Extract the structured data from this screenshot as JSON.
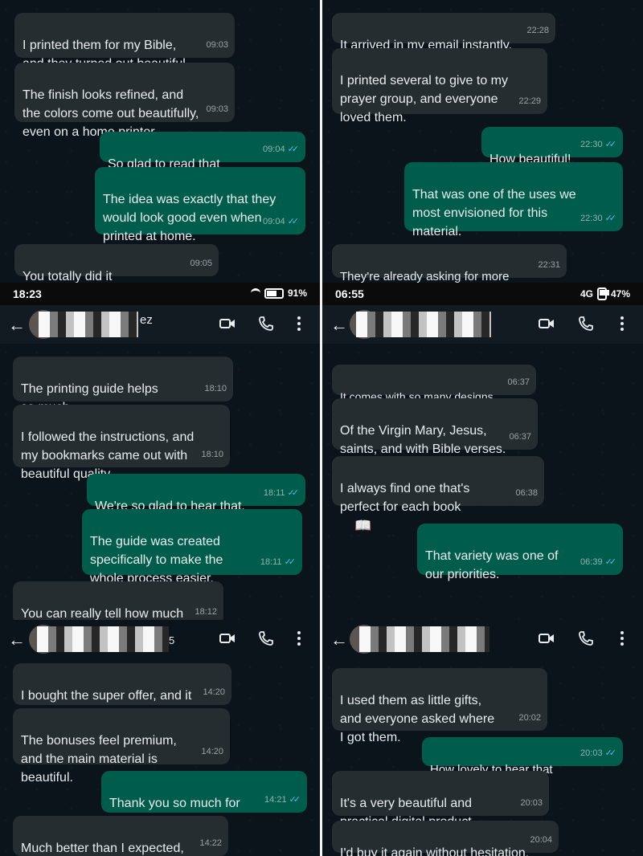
{
  "colors": {
    "incoming": "#262d31",
    "outgoing": "#005c4b",
    "background": "#0b141a",
    "ticks": "#53bdeb"
  },
  "icons": {
    "back": "arrow-left-icon",
    "video": "video-camera-icon",
    "call": "phone-icon",
    "menu": "more-vertical-icon",
    "read": "double-check-icon"
  },
  "panel_top_left": {
    "messages": [
      {
        "text": "I printed them for my Bible,\nand they turned out beautiful.",
        "time": "09:03"
      },
      {
        "text": "The finish looks refined, and\nthe colors come out beautifully,\neven on a home printer.",
        "time": "09:03"
      },
      {
        "text": "So glad to read that",
        "emoji": "🙏",
        "time": "09:04"
      },
      {
        "text": "The idea was exactly that they\nwould look good even when\nprinted at home.",
        "time": "09:04"
      },
      {
        "text": "You totally did it",
        "emoji": "❤️",
        "time": "09:05"
      }
    ]
  },
  "panel_top_right": {
    "messages": [
      {
        "text": "It arrived in my email instantly.",
        "time": "22:28"
      },
      {
        "text": "I printed several to give to my\nprayer group, and everyone\nloved them.",
        "time": "22:29"
      },
      {
        "text": "How beautiful!",
        "time": "22:30"
      },
      {
        "text": "That was one of the uses we\nmost envisioned for this\nmaterial.",
        "time": "22:30"
      },
      {
        "text": "They're already asking for more",
        "emoji": "😂",
        "time": "22:31"
      }
    ]
  },
  "panel_mid_left": {
    "status": {
      "time": "18:23",
      "battery": "91%"
    },
    "header": {
      "name_suffix": "ez"
    },
    "messages": [
      {
        "text": "The printing guide helps\nso much.",
        "time": "18:10"
      },
      {
        "text": "I followed the instructions, and\nmy bookmarks came out with\nbeautiful quality.",
        "time": "18:10"
      },
      {
        "text": "We're so glad to hear that.",
        "time": "18:11"
      },
      {
        "text": "The guide was created\nspecifically to make the\nwhole process easier.",
        "time": "18:11"
      },
      {
        "text": "You can really tell how much\ncare you put into it.",
        "time": "18:12"
      }
    ]
  },
  "panel_mid_right": {
    "status": {
      "time": "06:55",
      "network": "4G",
      "battery": "47%"
    },
    "messages": [
      {
        "text": "It comes with so many designs.",
        "time": "06:37"
      },
      {
        "text": "Of the Virgin Mary, Jesus,\nsaints, and with Bible verses.",
        "time": "06:37"
      },
      {
        "text": "I always find one that's\nperfect for each book",
        "emoji": "📖",
        "time": "06:38"
      },
      {
        "text": "That variety was one of\nour priorities.",
        "time": "06:39"
      }
    ]
  },
  "panel_bottom_left": {
    "header": {
      "name_suffix": "5"
    },
    "messages": [
      {
        "text": "I bought the super offer, and it\nwas totally worth it.",
        "time": "14:20"
      },
      {
        "text": "The bonuses feel premium,\nand the main material is\nbeautiful.",
        "time": "14:20"
      },
      {
        "text": "Thank you so much for\ntrusting us",
        "emoji": "❤️",
        "time": "14:21"
      },
      {
        "text": "Much better than I expected,\nhonestly.",
        "time": "14:22"
      }
    ]
  },
  "panel_bottom_right": {
    "messages": [
      {
        "text": "I used them as little gifts,\nand everyone asked where\nI got them.",
        "time": "20:02"
      },
      {
        "text": "How lovely to hear that",
        "emoji": "🙏",
        "time": "20:03"
      },
      {
        "text": "It's a very beautiful and\npractical digital product.",
        "time": "20:03"
      },
      {
        "text": "I'd buy it again without hesitation.",
        "time": "20:04"
      }
    ]
  }
}
